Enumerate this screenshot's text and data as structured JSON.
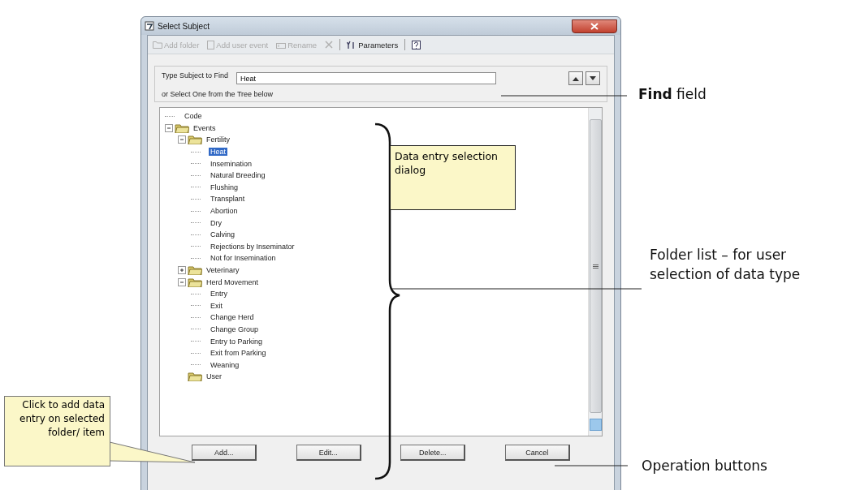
{
  "window": {
    "title": "Select Subject"
  },
  "toolbar": [
    {
      "label": "Add folder",
      "disabled": true
    },
    {
      "label": "Add user event",
      "disabled": true
    },
    {
      "label": "Rename",
      "disabled": true
    },
    {
      "disabled": true
    },
    {
      "label": "Parameters",
      "disabled": false
    },
    {
      "disabled": false
    }
  ],
  "find": {
    "label": "Type Subject to Find",
    "value": "Heat",
    "hint": "or Select One from the Tree below"
  },
  "tree": [
    {
      "label": "Code",
      "kind": "leaf",
      "selected": false
    },
    {
      "label": "Events",
      "kind": "folder",
      "expanded": true,
      "selected": false,
      "children": [
        {
          "label": "Fertility",
          "kind": "folder",
          "expanded": true,
          "selected": false,
          "children": [
            {
              "label": "Heat",
              "kind": "leaf",
              "selected": true
            },
            {
              "label": "Insemination",
              "kind": "leaf",
              "selected": false
            },
            {
              "label": "Natural Breeding",
              "kind": "leaf",
              "selected": false
            },
            {
              "label": "Flushing",
              "kind": "leaf",
              "selected": false
            },
            {
              "label": "Transplant",
              "kind": "leaf",
              "selected": false
            },
            {
              "label": "Abortion",
              "kind": "leaf",
              "selected": false
            },
            {
              "label": "Dry",
              "kind": "leaf",
              "selected": false
            },
            {
              "label": "Calving",
              "kind": "leaf",
              "selected": false
            },
            {
              "label": "Rejections by Inseminator",
              "kind": "leaf",
              "selected": false
            },
            {
              "label": "Not for Insemination",
              "kind": "leaf",
              "selected": false
            }
          ]
        },
        {
          "label": "Veterinary",
          "kind": "folder",
          "expanded": false,
          "selected": false
        },
        {
          "label": "Herd Movement",
          "kind": "folder",
          "expanded": true,
          "selected": false,
          "children": [
            {
              "label": "Entry",
              "kind": "leaf",
              "selected": false
            },
            {
              "label": "Exit",
              "kind": "leaf",
              "selected": false
            },
            {
              "label": "Change Herd",
              "kind": "leaf",
              "selected": false
            },
            {
              "label": "Change Group",
              "kind": "leaf",
              "selected": false
            },
            {
              "label": "Entry to Parking",
              "kind": "leaf",
              "selected": false
            },
            {
              "label": "Exit from Parking",
              "kind": "leaf",
              "selected": false
            },
            {
              "label": "Weaning",
              "kind": "leaf",
              "selected": false
            }
          ]
        },
        {
          "label": "User",
          "kind": "folder",
          "selected": false
        }
      ]
    }
  ],
  "buttons": [
    "Add...",
    "Edit...",
    "Delete...",
    "Cancel"
  ],
  "annotations": {
    "find_field": "**Find** field",
    "tree_note": "Data entry selection dialog",
    "folder_list": "Folder list – for user selection of data type",
    "operation_buttons": "Operation buttons",
    "add_callout": "Click to add data entry on selected folder/ item"
  }
}
